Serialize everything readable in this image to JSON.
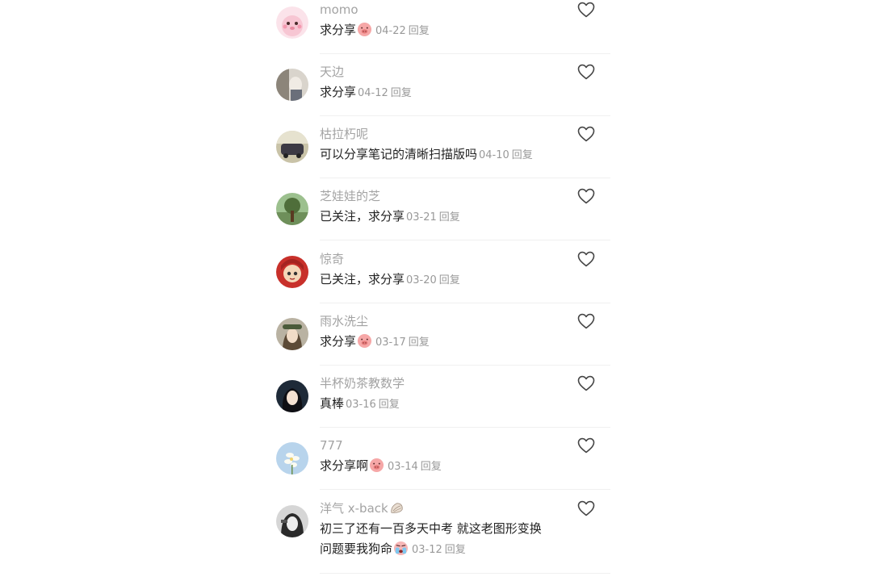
{
  "comments": [
    {
      "username": "momo",
      "text": "求分享",
      "emoji": "blushing-pig-face",
      "date": "04-22",
      "reply": "回复",
      "avatar": "pink-cartoon-avatar"
    },
    {
      "username": "天边",
      "text": "求分享",
      "date": "04-12",
      "reply": "回复",
      "avatar": "photo-avatar"
    },
    {
      "username": "枯拉朽呢",
      "text": "可以分享笔记的清晰扫描版吗",
      "date": "04-10",
      "reply": "回复",
      "avatar": "car-photo-avatar"
    },
    {
      "username": "芝娃娃的芝",
      "text": "已关注，求分享",
      "date": "03-21",
      "reply": "回复",
      "avatar": "tree-photo-avatar"
    },
    {
      "username": "惊奇",
      "text": "已关注，求分享",
      "date": "03-20",
      "reply": "回复",
      "avatar": "red-hair-cartoon-avatar"
    },
    {
      "username": "雨水洗尘",
      "text": "求分享",
      "emoji": "blushing-pig-face",
      "date": "03-17",
      "reply": "回复",
      "avatar": "girl-photo-avatar"
    },
    {
      "username": "半杯奶茶教数学",
      "text": "真棒",
      "date": "03-16",
      "reply": "回复",
      "avatar": "portrait-photo-avatar"
    },
    {
      "username": "777",
      "text": "求分享啊",
      "emoji": "blushing-pig-face",
      "date": "03-14",
      "reply": "回复",
      "avatar": "flower-photo-avatar"
    },
    {
      "username": "洋气 x-back",
      "username_emoji": "shell-icon",
      "text_line1": "初三了还有一百多天中考 就这老图形变换",
      "text_line2": "问题要我狗命",
      "emoji": "crying-face",
      "date": "03-12",
      "reply": "回复",
      "avatar": "bw-portrait-avatar"
    }
  ],
  "colors": {
    "username": "#a3a3a3",
    "text": "#222222",
    "meta": "#999999",
    "heart": "#444444",
    "divider": "#f0f0f0"
  }
}
